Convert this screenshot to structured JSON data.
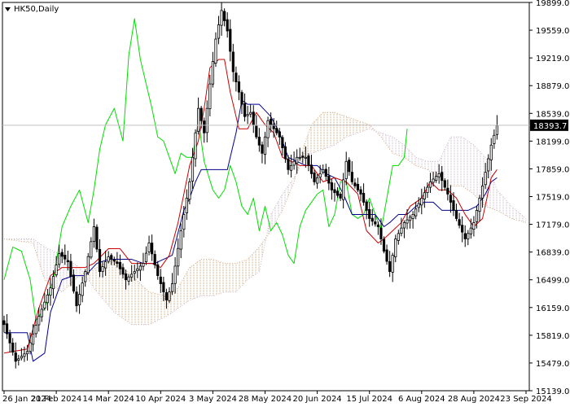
{
  "chart_data": {
    "type": "candlestick",
    "symbol_label": "HK50,Daily",
    "current_price": "18393.7",
    "y_ticks": [
      {
        "value": 19899,
        "label": "19899.0"
      },
      {
        "value": 19559,
        "label": "19559.0"
      },
      {
        "value": 19219,
        "label": "19219.0"
      },
      {
        "value": 18879,
        "label": "18879.0"
      },
      {
        "value": 18539,
        "label": "18539.0"
      },
      {
        "value": 18199,
        "label": "18199.0"
      },
      {
        "value": 17859,
        "label": "17859.0"
      },
      {
        "value": 17519,
        "label": "17519.0"
      },
      {
        "value": 17179,
        "label": "17179.0"
      },
      {
        "value": 16839,
        "label": "16839.0"
      },
      {
        "value": 16499,
        "label": "16499.0"
      },
      {
        "value": 16159,
        "label": "16159.0"
      },
      {
        "value": 15819,
        "label": "15819.0"
      },
      {
        "value": 15479,
        "label": "15479.0"
      },
      {
        "value": 15139,
        "label": "15139.0"
      }
    ],
    "x_ticks": [
      {
        "index": 0,
        "label": "26 Jan 2024"
      },
      {
        "index": 18,
        "label": "21 Feb 2024"
      },
      {
        "index": 36,
        "label": "14 Mar 2024"
      },
      {
        "index": 54,
        "label": "10 Apr 2024"
      },
      {
        "index": 72,
        "label": "3 May 2024"
      },
      {
        "index": 90,
        "label": "28 May 2024"
      },
      {
        "index": 108,
        "label": "20 Jun 2024"
      },
      {
        "index": 126,
        "label": "15 Jul 2024"
      },
      {
        "index": 144,
        "label": "6 Aug 2024"
      },
      {
        "index": 162,
        "label": "28 Aug 2024"
      },
      {
        "index": 180,
        "label": "23 Sep 2024"
      }
    ],
    "ylim": [
      15139,
      19899
    ],
    "x_count": 181,
    "colors": {
      "candle": "#000000",
      "tenkan": "#cc0000",
      "kijun": "#00008b",
      "chikou": "#00dd00",
      "cloud_bull": "#d2a679",
      "cloud_bear": "#c8b4c8",
      "price_line": "#c0c0c0",
      "price_tag_bg": "#000000"
    },
    "anchors": {
      "close": [
        [
          0,
          15950
        ],
        [
          4,
          15500
        ],
        [
          8,
          15620
        ],
        [
          12,
          16050
        ],
        [
          16,
          16400
        ],
        [
          19,
          16820
        ],
        [
          22,
          16720
        ],
        [
          25,
          16180
        ],
        [
          28,
          16600
        ],
        [
          31,
          17150
        ],
        [
          33,
          16600
        ],
        [
          36,
          16780
        ],
        [
          39,
          16700
        ],
        [
          42,
          16500
        ],
        [
          45,
          16600
        ],
        [
          48,
          16700
        ],
        [
          50,
          16950
        ],
        [
          53,
          16550
        ],
        [
          56,
          16250
        ],
        [
          58,
          16450
        ],
        [
          61,
          17100
        ],
        [
          64,
          17700
        ],
        [
          67,
          18600
        ],
        [
          69,
          18300
        ],
        [
          71,
          18900
        ],
        [
          73,
          19450
        ],
        [
          75,
          19800
        ],
        [
          77,
          19550
        ],
        [
          79,
          19050
        ],
        [
          81,
          18800
        ],
        [
          83,
          18500
        ],
        [
          85,
          18550
        ],
        [
          87,
          18250
        ],
        [
          89,
          18050
        ],
        [
          91,
          18450
        ],
        [
          93,
          18350
        ],
        [
          95,
          18250
        ],
        [
          98,
          17850
        ],
        [
          101,
          18000
        ],
        [
          104,
          18000
        ],
        [
          107,
          17700
        ],
        [
          110,
          17850
        ],
        [
          113,
          17600
        ],
        [
          116,
          17500
        ],
        [
          118,
          17950
        ],
        [
          120,
          17700
        ],
        [
          123,
          17550
        ],
        [
          126,
          17250
        ],
        [
          129,
          17150
        ],
        [
          131,
          16850
        ],
        [
          133,
          16600
        ],
        [
          135,
          17000
        ],
        [
          138,
          17200
        ],
        [
          141,
          17300
        ],
        [
          144,
          17500
        ],
        [
          147,
          17700
        ],
        [
          150,
          17800
        ],
        [
          153,
          17550
        ],
        [
          156,
          17250
        ],
        [
          159,
          17000
        ],
        [
          162,
          17200
        ],
        [
          165,
          17650
        ],
        [
          168,
          18150
        ],
        [
          170,
          18390
        ]
      ],
      "tenkan": [
        [
          0,
          15600
        ],
        [
          8,
          15650
        ],
        [
          12,
          16150
        ],
        [
          16,
          16550
        ],
        [
          20,
          16650
        ],
        [
          24,
          16650
        ],
        [
          28,
          16650
        ],
        [
          31,
          16700
        ],
        [
          36,
          16880
        ],
        [
          40,
          16880
        ],
        [
          44,
          16700
        ],
        [
          48,
          16700
        ],
        [
          51,
          16700
        ],
        [
          54,
          16650
        ],
        [
          57,
          16800
        ],
        [
          60,
          17200
        ],
        [
          64,
          17900
        ],
        [
          67,
          18200
        ],
        [
          69,
          18600
        ],
        [
          71,
          19100
        ],
        [
          74,
          19200
        ],
        [
          76,
          19200
        ],
        [
          78,
          18800
        ],
        [
          81,
          18350
        ],
        [
          84,
          18350
        ],
        [
          87,
          18550
        ],
        [
          90,
          18400
        ],
        [
          93,
          18300
        ],
        [
          96,
          18000
        ],
        [
          99,
          17950
        ],
        [
          102,
          17900
        ],
        [
          106,
          17900
        ],
        [
          110,
          17700
        ],
        [
          114,
          17750
        ],
        [
          118,
          17700
        ],
        [
          122,
          17550
        ],
        [
          125,
          17100
        ],
        [
          129,
          16950
        ],
        [
          131,
          17000
        ],
        [
          134,
          17100
        ],
        [
          137,
          17200
        ],
        [
          140,
          17400
        ],
        [
          144,
          17500
        ],
        [
          147,
          17700
        ],
        [
          150,
          17600
        ],
        [
          153,
          17600
        ],
        [
          156,
          17500
        ],
        [
          159,
          17300
        ],
        [
          162,
          17150
        ],
        [
          165,
          17250
        ],
        [
          168,
          17750
        ],
        [
          170,
          17850
        ]
      ],
      "kijun": [
        [
          0,
          15850
        ],
        [
          8,
          15850
        ],
        [
          10,
          15500
        ],
        [
          14,
          15600
        ],
        [
          16,
          16100
        ],
        [
          20,
          16500
        ],
        [
          24,
          16550
        ],
        [
          28,
          16550
        ],
        [
          32,
          16700
        ],
        [
          36,
          16750
        ],
        [
          40,
          16750
        ],
        [
          44,
          16750
        ],
        [
          48,
          16700
        ],
        [
          52,
          16700
        ],
        [
          55,
          16750
        ],
        [
          58,
          16800
        ],
        [
          62,
          17350
        ],
        [
          64,
          17500
        ],
        [
          66,
          17700
        ],
        [
          68,
          17850
        ],
        [
          70,
          17850
        ],
        [
          74,
          17850
        ],
        [
          77,
          17850
        ],
        [
          80,
          18300
        ],
        [
          82,
          18700
        ],
        [
          84,
          18650
        ],
        [
          88,
          18650
        ],
        [
          92,
          18500
        ],
        [
          95,
          18300
        ],
        [
          98,
          18000
        ],
        [
          101,
          17950
        ],
        [
          104,
          17900
        ],
        [
          108,
          17900
        ],
        [
          111,
          17800
        ],
        [
          114,
          17750
        ],
        [
          117,
          17550
        ],
        [
          120,
          17300
        ],
        [
          124,
          17300
        ],
        [
          128,
          17300
        ],
        [
          131,
          17150
        ],
        [
          133,
          17200
        ],
        [
          136,
          17300
        ],
        [
          139,
          17300
        ],
        [
          142,
          17400
        ],
        [
          145,
          17450
        ],
        [
          148,
          17450
        ],
        [
          151,
          17350
        ],
        [
          154,
          17350
        ],
        [
          157,
          17350
        ],
        [
          160,
          17350
        ],
        [
          163,
          17400
        ],
        [
          166,
          17550
        ],
        [
          168,
          17700
        ],
        [
          170,
          17750
        ]
      ],
      "chikou": [
        [
          0,
          16500
        ],
        [
          3,
          16900
        ],
        [
          6,
          16850
        ],
        [
          9,
          16500
        ],
        [
          11,
          16000
        ],
        [
          14,
          16150
        ],
        [
          17,
          16500
        ],
        [
          20,
          17150
        ],
        [
          23,
          17400
        ],
        [
          26,
          17600
        ],
        [
          29,
          17200
        ],
        [
          31,
          17600
        ],
        [
          33,
          18100
        ],
        [
          35,
          18400
        ],
        [
          38,
          18600
        ],
        [
          41,
          18200
        ],
        [
          43,
          19250
        ],
        [
          45,
          19700
        ],
        [
          47,
          19200
        ],
        [
          49,
          18900
        ],
        [
          51,
          18600
        ],
        [
          53,
          18250
        ],
        [
          55,
          18200
        ],
        [
          57,
          18000
        ],
        [
          59,
          17800
        ],
        [
          61,
          18050
        ],
        [
          63,
          18000
        ],
        [
          65,
          18000
        ],
        [
          67,
          18450
        ],
        [
          69,
          17950
        ],
        [
          72,
          17600
        ],
        [
          74,
          17500
        ],
        [
          76,
          17600
        ],
        [
          78,
          17900
        ],
        [
          80,
          17700
        ],
        [
          82,
          17400
        ],
        [
          84,
          17300
        ],
        [
          86,
          17500
        ],
        [
          88,
          17100
        ],
        [
          90,
          17400
        ],
        [
          92,
          17100
        ],
        [
          94,
          17200
        ],
        [
          96,
          17050
        ],
        [
          98,
          16800
        ],
        [
          100,
          16700
        ],
        [
          102,
          17150
        ],
        [
          104,
          17350
        ],
        [
          106,
          17450
        ],
        [
          108,
          17550
        ],
        [
          110,
          17600
        ],
        [
          112,
          17150
        ],
        [
          114,
          17300
        ],
        [
          116,
          17700
        ],
        [
          118,
          17700
        ],
        [
          120,
          17300
        ],
        [
          122,
          17250
        ],
        [
          124,
          17300
        ],
        [
          126,
          17500
        ],
        [
          128,
          17300
        ],
        [
          130,
          17100
        ],
        [
          132,
          17500
        ],
        [
          134,
          17900
        ],
        [
          136,
          17900
        ],
        [
          138,
          18000
        ],
        [
          139,
          18350
        ]
      ],
      "span_a": [
        [
          0,
          17000
        ],
        [
          10,
          16950
        ],
        [
          14,
          16500
        ],
        [
          20,
          16350
        ],
        [
          26,
          16550
        ],
        [
          32,
          16650
        ],
        [
          38,
          16750
        ],
        [
          44,
          16550
        ],
        [
          50,
          16350
        ],
        [
          56,
          16300
        ],
        [
          60,
          16400
        ],
        [
          64,
          16650
        ],
        [
          68,
          16750
        ],
        [
          72,
          16750
        ],
        [
          76,
          16700
        ],
        [
          80,
          16700
        ],
        [
          84,
          16750
        ],
        [
          88,
          16900
        ],
        [
          92,
          17100
        ],
        [
          96,
          17350
        ],
        [
          100,
          17700
        ],
        [
          103,
          18100
        ],
        [
          106,
          18400
        ],
        [
          110,
          18550
        ],
        [
          114,
          18550
        ],
        [
          118,
          18500
        ],
        [
          122,
          18450
        ],
        [
          126,
          18400
        ],
        [
          130,
          18250
        ],
        [
          134,
          18050
        ],
        [
          138,
          18000
        ],
        [
          142,
          17900
        ],
        [
          146,
          17850
        ],
        [
          150,
          17750
        ],
        [
          154,
          17650
        ],
        [
          158,
          17650
        ],
        [
          162,
          17550
        ],
        [
          166,
          17400
        ],
        [
          170,
          17350
        ],
        [
          175,
          17250
        ],
        [
          180,
          17200
        ]
      ],
      "span_b": [
        [
          0,
          17000
        ],
        [
          10,
          17000
        ],
        [
          14,
          16900
        ],
        [
          20,
          16800
        ],
        [
          26,
          16650
        ],
        [
          32,
          16350
        ],
        [
          38,
          16100
        ],
        [
          44,
          15950
        ],
        [
          50,
          15950
        ],
        [
          56,
          16050
        ],
        [
          60,
          16150
        ],
        [
          64,
          16250
        ],
        [
          68,
          16300
        ],
        [
          72,
          16300
        ],
        [
          76,
          16350
        ],
        [
          80,
          16350
        ],
        [
          84,
          16500
        ],
        [
          88,
          16600
        ],
        [
          92,
          17300
        ],
        [
          96,
          17550
        ],
        [
          100,
          17750
        ],
        [
          103,
          17950
        ],
        [
          106,
          18050
        ],
        [
          110,
          18100
        ],
        [
          114,
          18150
        ],
        [
          118,
          18250
        ],
        [
          122,
          18300
        ],
        [
          126,
          18350
        ],
        [
          130,
          18300
        ],
        [
          134,
          18250
        ],
        [
          138,
          18150
        ],
        [
          142,
          18000
        ],
        [
          146,
          17950
        ],
        [
          150,
          17950
        ],
        [
          154,
          18250
        ],
        [
          158,
          18250
        ],
        [
          162,
          18150
        ],
        [
          166,
          18000
        ],
        [
          170,
          17600
        ],
        [
          175,
          17400
        ],
        [
          180,
          17250
        ]
      ]
    }
  }
}
